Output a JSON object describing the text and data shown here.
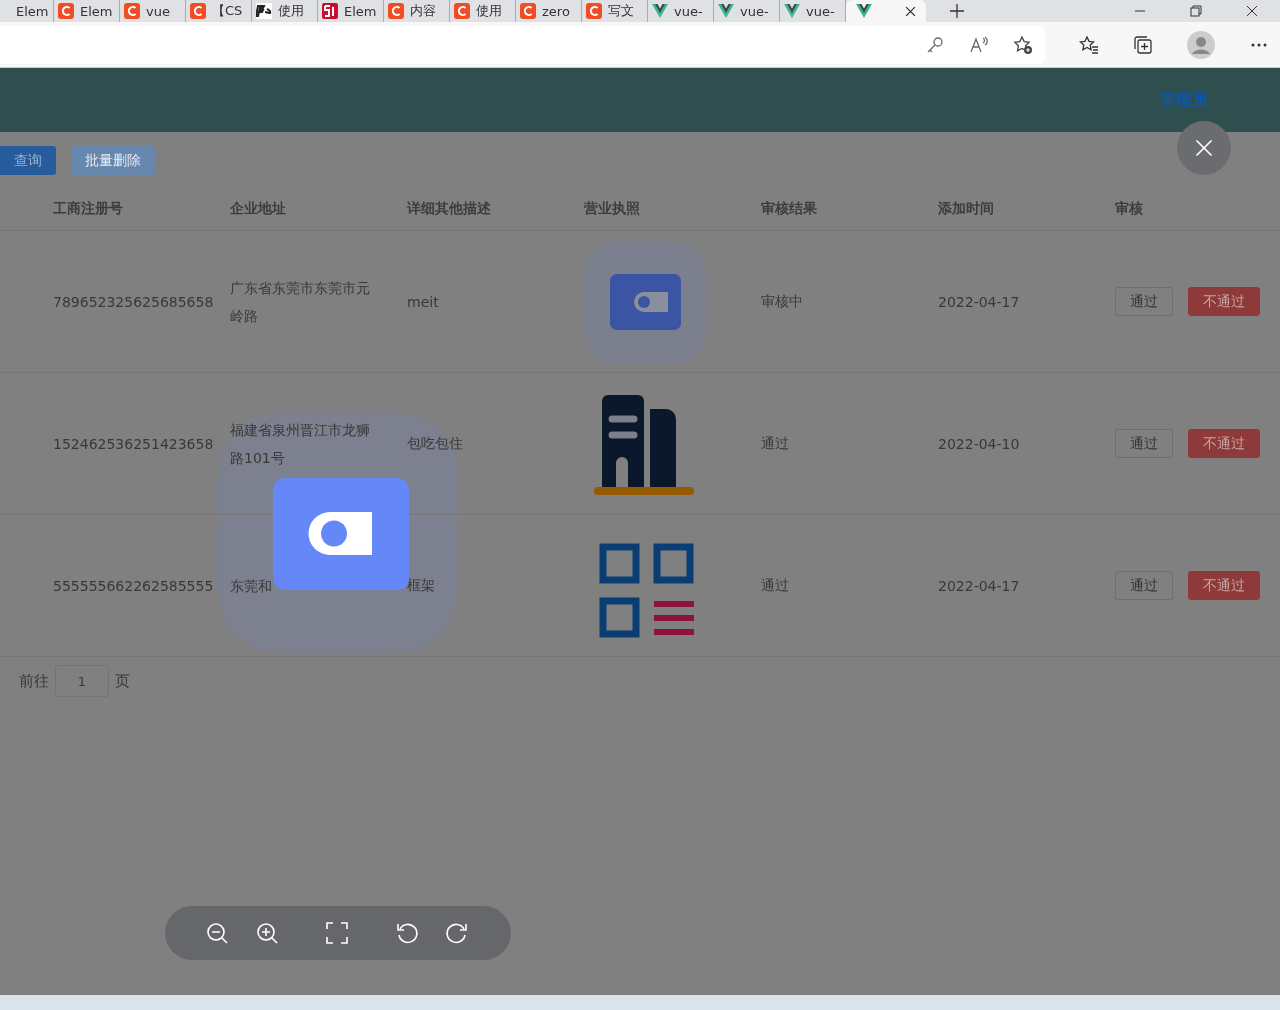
{
  "browser": {
    "tabs": [
      {
        "label": "Elem",
        "kind": "plain",
        "selected": false
      },
      {
        "label": "Elem",
        "kind": "c",
        "selected": false
      },
      {
        "label": "vue",
        "kind": "c",
        "selected": false
      },
      {
        "label": "【CS",
        "kind": "c",
        "selected": false
      },
      {
        "label": "使用",
        "kind": "fs",
        "selected": false
      },
      {
        "label": "Elem",
        "kind": "n51",
        "selected": false
      },
      {
        "label": "内容",
        "kind": "c",
        "selected": false
      },
      {
        "label": "使用",
        "kind": "c",
        "selected": false
      },
      {
        "label": "zero",
        "kind": "c",
        "selected": false
      },
      {
        "label": "写文",
        "kind": "c",
        "selected": false
      },
      {
        "label": "vue-",
        "kind": "v",
        "selected": false
      },
      {
        "label": "vue-",
        "kind": "v",
        "selected": false
      },
      {
        "label": "vue-",
        "kind": "v",
        "selected": false
      },
      {
        "kind": "v",
        "selected": true
      }
    ]
  },
  "header": {
    "user": "管理员"
  },
  "toolbar": {
    "buttons": [
      {
        "label": "查询",
        "disabled": false
      },
      {
        "label": "批量删除",
        "disabled": true
      }
    ]
  },
  "table": {
    "columns": [
      "工商注册号",
      "企业地址",
      "详细其他描述",
      "营业执照",
      "审核结果",
      "添加时间",
      "审核"
    ],
    "rows": [
      {
        "reg_no": "789652325625685658",
        "address": "广东省东莞市东莞市元岭路",
        "description": "meit",
        "kind": "card",
        "result": "审核中",
        "added": "2022-04-17",
        "actions": [
          "通过",
          "不通过"
        ]
      },
      {
        "reg_no": "152462536251423658",
        "address": "福建省泉州晋江市龙狮路101号",
        "description": "包吃包住",
        "kind": "building",
        "result": "通过",
        "added": "2022-04-10",
        "actions": [
          "通过",
          "不通过"
        ]
      },
      {
        "reg_no": "555555662262585555",
        "address": "东莞和",
        "description": "框架",
        "kind": "grid",
        "result": "通过",
        "added": "2022-04-17",
        "actions": [
          "通过",
          "不通过"
        ]
      }
    ]
  },
  "pagination": {
    "prefix": "前往",
    "page": "1",
    "suffix": "页"
  }
}
